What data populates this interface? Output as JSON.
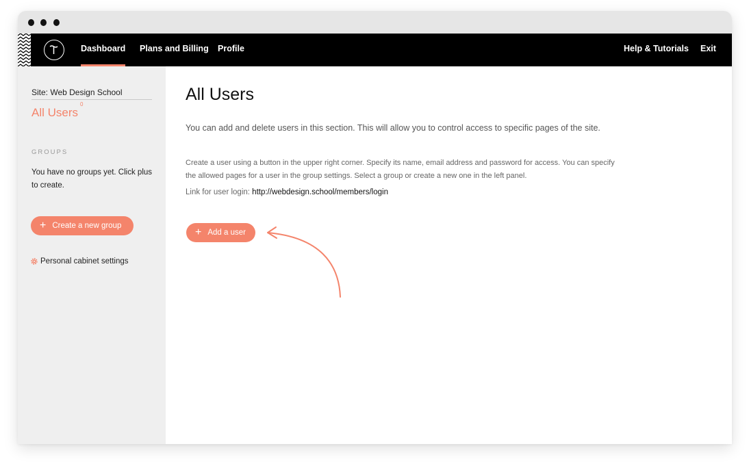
{
  "nav": {
    "items": [
      {
        "label": "Dashboard",
        "active": true
      },
      {
        "label": "Plans and Billing",
        "active": false
      },
      {
        "label": "Profile",
        "active": false
      }
    ],
    "right_items": [
      {
        "label": "Help & Tutorials"
      },
      {
        "label": "Exit"
      }
    ]
  },
  "sidebar": {
    "site_label": "Site: Web Design School",
    "title": "All Users",
    "user_count": "0",
    "groups_heading": "GROUPS",
    "groups_empty": "You have no groups yet. Click plus to create.",
    "create_group_label": "Create a new group",
    "settings_label": "Personal cabinet settings"
  },
  "main": {
    "title": "All Users",
    "intro": "You can add and delete users in this section. This will allow you to control access to specific pages of the site.",
    "instructions": "Create a user using a button in the upper right corner. Specify its name, email address and password for access. You can specify the allowed pages for a user in the group settings. Select a group or create a new one in the left panel.",
    "login_label": "Link for user login:",
    "login_url": "http://webdesign.school/members/login",
    "add_user_label": "Add a user"
  },
  "colors": {
    "accent": "#f4846b",
    "navbar": "#000000",
    "sidebar_bg": "#efefef",
    "titlebar": "#e6e6e6"
  },
  "icons": {
    "logo": "tilda-logo-icon",
    "plus": "plus-icon",
    "gear": "gear-icon",
    "arrow": "curved-arrow-icon"
  }
}
